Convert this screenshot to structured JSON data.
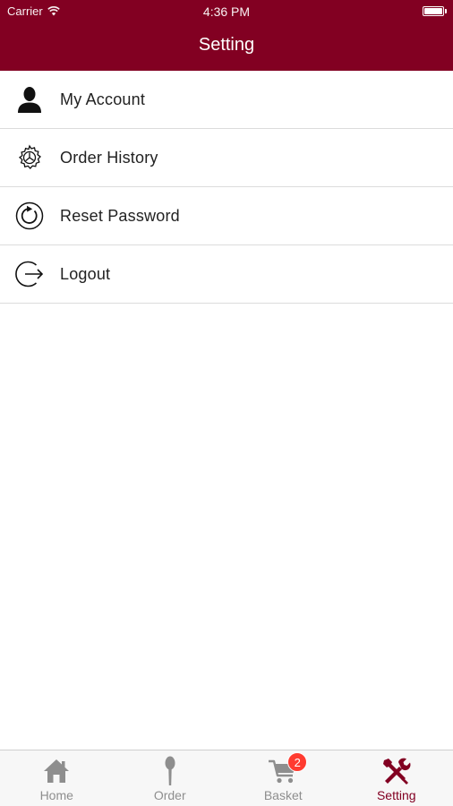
{
  "status_bar": {
    "carrier": "Carrier",
    "time": "4:36 PM"
  },
  "header": {
    "title": "Setting",
    "color": "#820022"
  },
  "menu": {
    "items": [
      {
        "label": "My Account",
        "icon": "user-icon"
      },
      {
        "label": "Order History",
        "icon": "gear-icon"
      },
      {
        "label": "Reset Password",
        "icon": "refresh-icon"
      },
      {
        "label": "Logout",
        "icon": "logout-icon"
      }
    ]
  },
  "tabbar": {
    "tabs": [
      {
        "label": "Home",
        "icon": "home-icon"
      },
      {
        "label": "Order",
        "icon": "spoon-icon"
      },
      {
        "label": "Basket",
        "icon": "cart-icon",
        "badge": "2"
      },
      {
        "label": "Setting",
        "icon": "tools-icon",
        "active": true
      }
    ],
    "active_color": "#820022",
    "inactive_color": "#8e8e8e",
    "badge_color": "#ff3b30"
  }
}
